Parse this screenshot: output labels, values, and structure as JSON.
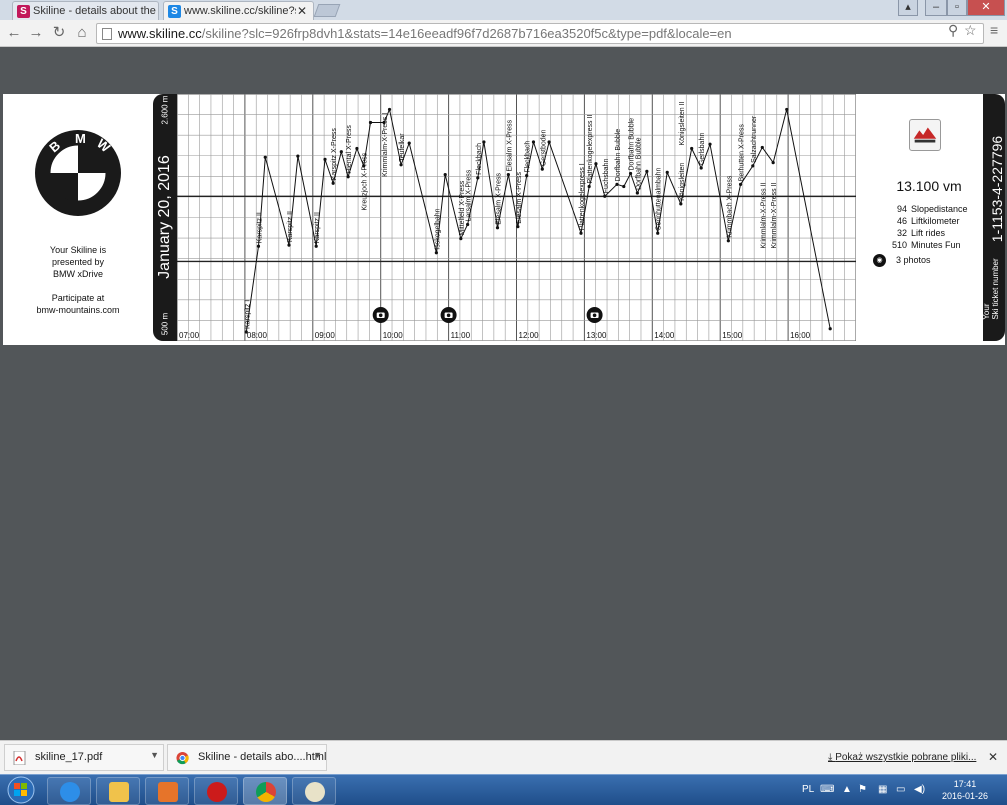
{
  "browser": {
    "tabs": [
      {
        "label": "Skiline - details about the",
        "favicon": "S",
        "color": "#c2185b"
      },
      {
        "label": "www.skiline.cc/skiline?slc=",
        "favicon": "S",
        "color": "#1e88e5"
      }
    ],
    "url_host": "www.skiline.cc",
    "url_path": "/skiline?slc=926frp8dvh1&stats=14e16eeadf96f7d2687b716ea3520f5c&type=pdf&locale=en"
  },
  "ticket": {
    "brand": "BMW",
    "presented_lines": [
      "Your Skiline is",
      "presented by",
      "BMW xDrive"
    ],
    "participate_lines": [
      "Participate at",
      "bmw-mountains.com"
    ],
    "date": "January 20, 2016",
    "y_top_label": "2.600 m",
    "y_bottom_label": "500 m",
    "total_vm": "13.100 vm",
    "stats": [
      {
        "num": "94",
        "label": "Slopedistance"
      },
      {
        "num": "46",
        "label": "Liftkilometer"
      },
      {
        "num": "32",
        "label": "Lift rides"
      },
      {
        "num": "510",
        "label": "Minutes Fun"
      }
    ],
    "photos_num": "3",
    "photos_label": "photos",
    "ticket_label_lines": [
      "Your",
      "Ski ticket number"
    ],
    "ticket_number": "1-1153-4-227796"
  },
  "chart_data": {
    "type": "line",
    "x_unit": "hour",
    "x_ticks": [
      "07:00",
      "08:00",
      "09:00",
      "10:00",
      "11:00",
      "12:00",
      "13:00",
      "14:00",
      "15:00",
      "16:00"
    ],
    "xlim": [
      7.0,
      17.0
    ],
    "y_labels": [
      "2.600 m",
      "500 m"
    ],
    "ylim": [
      500,
      2600
    ],
    "points": [
      [
        8.02,
        500
      ],
      [
        8.2,
        1290
      ],
      [
        8.3,
        2110
      ],
      [
        8.65,
        1300
      ],
      [
        8.78,
        2120
      ],
      [
        9.05,
        1290
      ],
      [
        9.18,
        2090
      ],
      [
        9.3,
        1870
      ],
      [
        9.42,
        2160
      ],
      [
        9.52,
        1930
      ],
      [
        9.65,
        2190
      ],
      [
        9.75,
        2030
      ],
      [
        9.85,
        2430
      ],
      [
        10.05,
        2430
      ],
      [
        10.13,
        2550
      ],
      [
        10.3,
        2040
      ],
      [
        10.42,
        2240
      ],
      [
        10.82,
        1230
      ],
      [
        10.95,
        1950
      ],
      [
        11.18,
        1360
      ],
      [
        11.28,
        1490
      ],
      [
        11.43,
        1920
      ],
      [
        11.52,
        2250
      ],
      [
        11.72,
        1460
      ],
      [
        11.88,
        1950
      ],
      [
        12.02,
        1470
      ],
      [
        12.15,
        1940
      ],
      [
        12.25,
        2250
      ],
      [
        12.38,
        2000
      ],
      [
        12.48,
        2250
      ],
      [
        12.95,
        1410
      ],
      [
        13.07,
        1840
      ],
      [
        13.17,
        2050
      ],
      [
        13.3,
        1750
      ],
      [
        13.48,
        1860
      ],
      [
        13.58,
        1840
      ],
      [
        13.68,
        1960
      ],
      [
        13.78,
        1780
      ],
      [
        13.92,
        1980
      ],
      [
        14.08,
        1410
      ],
      [
        14.22,
        1970
      ],
      [
        14.42,
        1680
      ],
      [
        14.58,
        2190
      ],
      [
        14.72,
        2010
      ],
      [
        14.85,
        2230
      ],
      [
        15.12,
        1340
      ],
      [
        15.3,
        1860
      ],
      [
        15.48,
        2030
      ],
      [
        15.62,
        2200
      ],
      [
        15.78,
        2060
      ],
      [
        15.98,
        2550
      ],
      [
        16.62,
        530
      ]
    ],
    "lift_labels": [
      {
        "t": 8.02,
        "h": 500,
        "text": "Karspitz I"
      },
      {
        "t": 8.2,
        "h": 1290,
        "text": "Karspitz II"
      },
      {
        "t": 8.65,
        "h": 1300,
        "text": "Karspitz II"
      },
      {
        "t": 9.05,
        "h": 1290,
        "text": "Karspitz II"
      },
      {
        "t": 9.3,
        "h": 1870,
        "text": "Karspitz X-Press"
      },
      {
        "t": 9.52,
        "h": 1930,
        "text": "Hiental X-Press"
      },
      {
        "t": 9.75,
        "h": 1590,
        "text": "Kreuzjoch X-Press"
      },
      {
        "t": 10.05,
        "h": 1900,
        "text": "Krimmlalm-X-Press I"
      },
      {
        "t": 10.3,
        "h": 2040,
        "text": "Teufelkar"
      },
      {
        "t": 10.82,
        "h": 1230,
        "text": "Isskogelbahn"
      },
      {
        "t": 11.18,
        "h": 1360,
        "text": "Mittelfeld X-Press"
      },
      {
        "t": 11.28,
        "h": 1490,
        "text": "Larsalm X-Press"
      },
      {
        "t": 11.43,
        "h": 1920,
        "text": "Fleckbach"
      },
      {
        "t": 11.72,
        "h": 1460,
        "text": "Elesalm X-Press"
      },
      {
        "t": 11.88,
        "h": 1950,
        "text": "Elesalm X-Press"
      },
      {
        "t": 12.02,
        "h": 1470,
        "text": "Elesalm X-Press"
      },
      {
        "t": 12.15,
        "h": 1940,
        "text": "Fleckbach"
      },
      {
        "t": 12.38,
        "h": 2000,
        "text": "Gerstboden"
      },
      {
        "t": 12.95,
        "h": 1410,
        "text": "Plattenkogelexpress I"
      },
      {
        "t": 13.07,
        "h": 1840,
        "text": "Plattenkogelexpress II"
      },
      {
        "t": 13.3,
        "h": 1750,
        "text": "Fuchsbahn"
      },
      {
        "t": 13.48,
        "h": 1860,
        "text": "Dorfbahn Bubble"
      },
      {
        "t": 13.68,
        "h": 1960,
        "text": "Dorfbahn Bubble"
      },
      {
        "t": 13.78,
        "h": 1780,
        "text": "Dorfbahn Bubble"
      },
      {
        "t": 14.08,
        "h": 1410,
        "text": "Sennhuttenalmbahn"
      },
      {
        "t": 14.42,
        "h": 1680,
        "text": "Königsleiten"
      },
      {
        "t": 14.42,
        "h": 2190,
        "text": "Königsleiten II"
      },
      {
        "t": 14.72,
        "h": 2010,
        "text": "Gerlsbahn"
      },
      {
        "t": 15.12,
        "h": 1340,
        "text": "Krimmbach X-Press"
      },
      {
        "t": 15.3,
        "h": 1860,
        "text": "Berhutten X-Press"
      },
      {
        "t": 15.48,
        "h": 2030,
        "text": "Salzachtrunner"
      },
      {
        "t": 15.62,
        "h": 1240,
        "text": "Krimmlalm-X-Press II"
      },
      {
        "t": 15.78,
        "h": 1240,
        "text": "Krimmlalm-X-Press II"
      }
    ],
    "photo_times": [
      10.0,
      11.0,
      13.15
    ],
    "grid": true
  },
  "downloads": {
    "items": [
      {
        "label": "skiline_17.pdf",
        "icon": "pdf-icon"
      },
      {
        "label": "Skiline - details abo....html",
        "icon": "chrome-icon"
      }
    ],
    "show_all": "Pokaż wszystkie pobrane pliki..."
  },
  "taskbar": {
    "lang": "PL",
    "time": "17:41",
    "date": "2016-01-26"
  }
}
